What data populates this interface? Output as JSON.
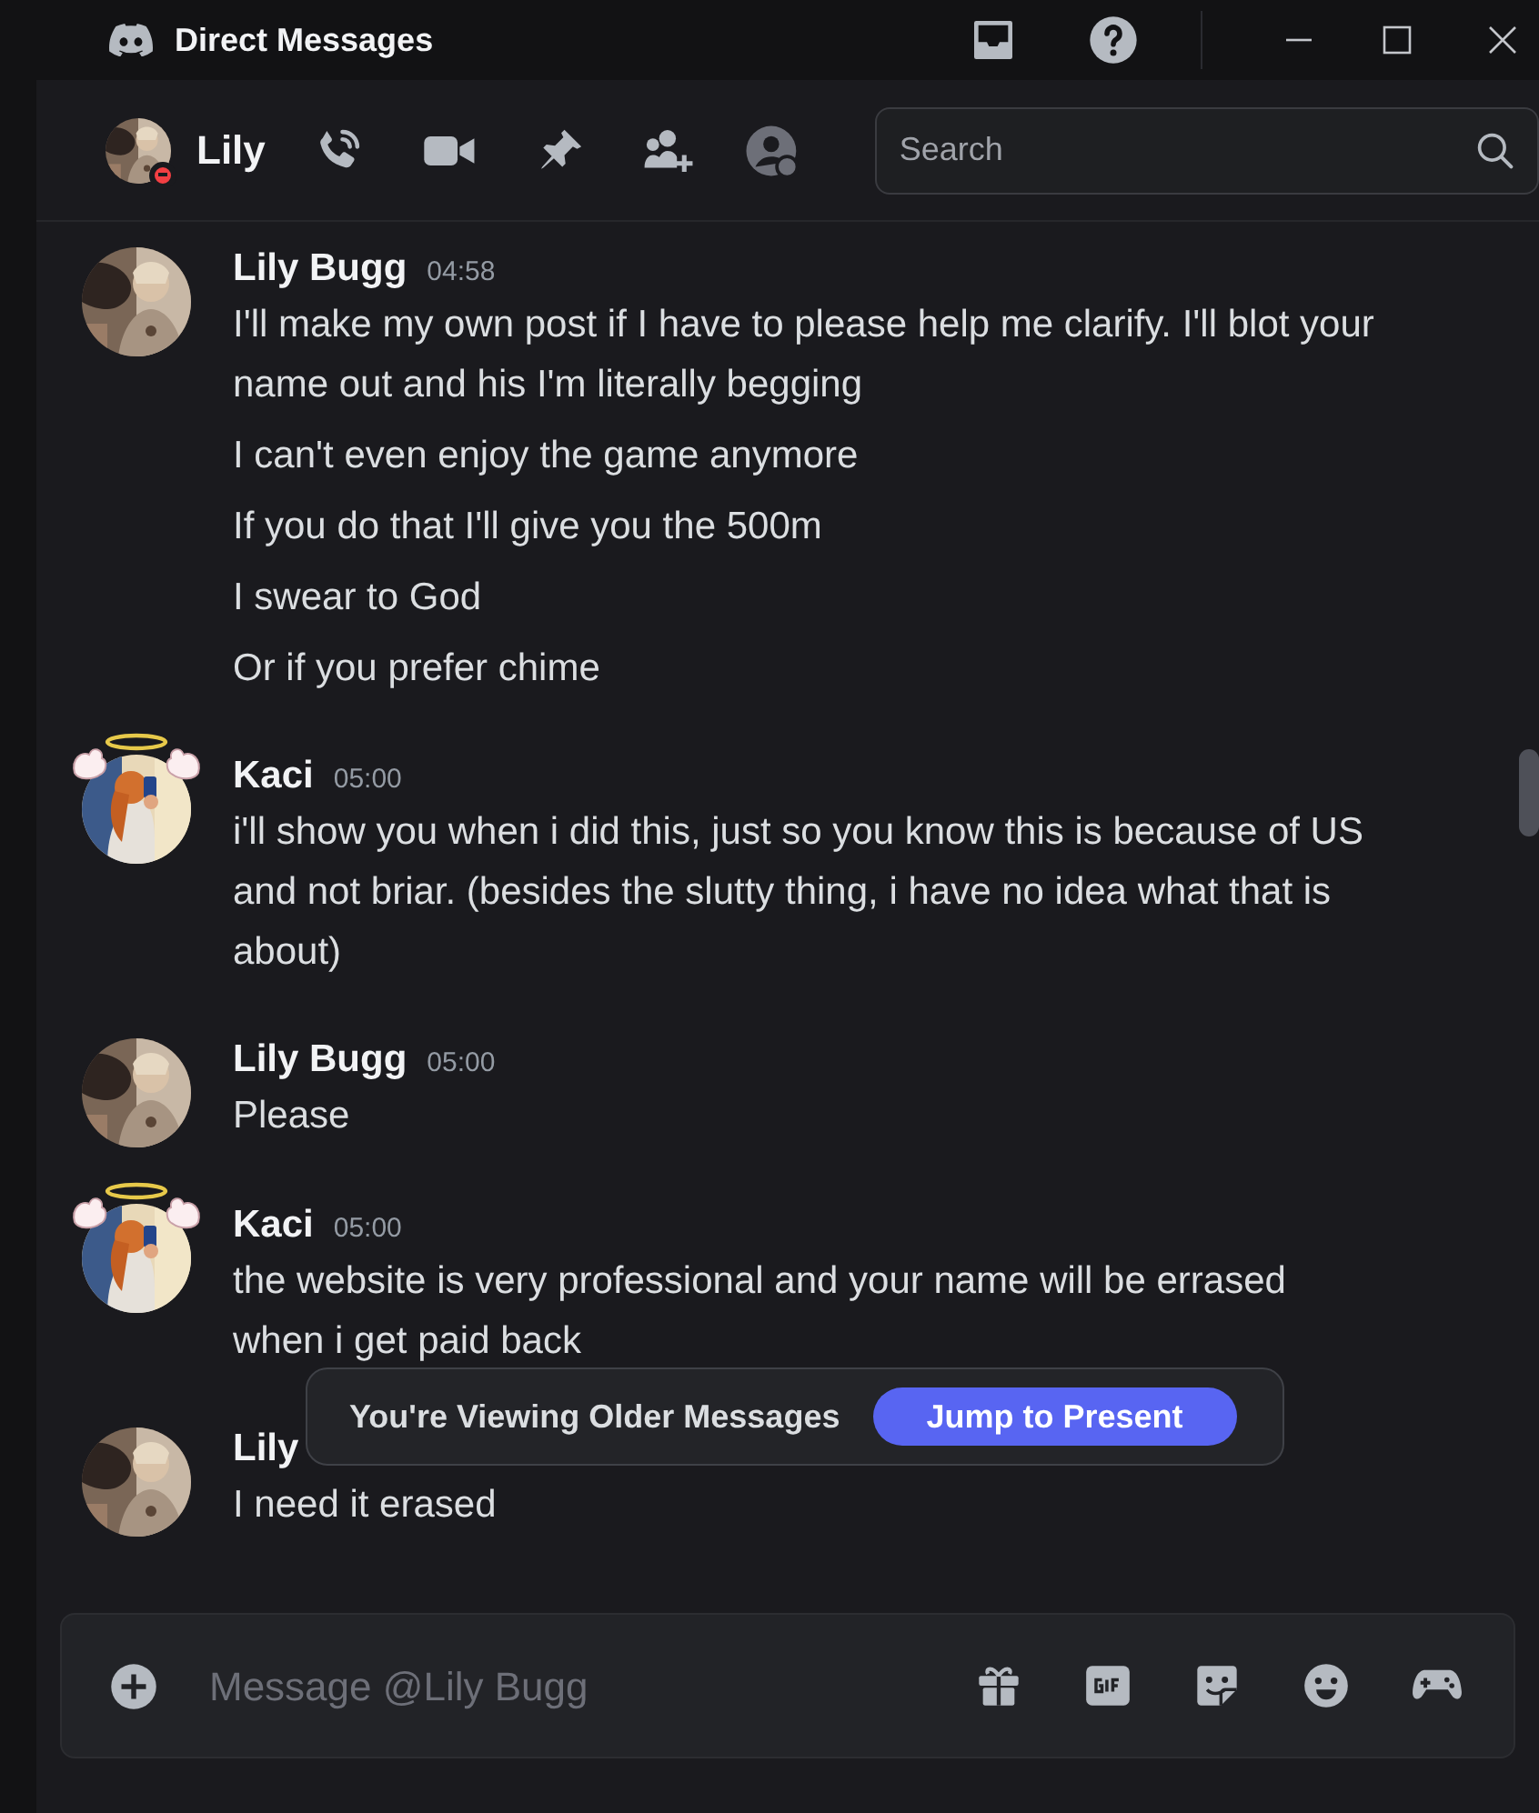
{
  "title_bar": {
    "title": "Direct Messages"
  },
  "header": {
    "name": "Lily",
    "do_not_disturb": true,
    "search": {
      "placeholder": "Search"
    }
  },
  "messages": [
    {
      "author": "Lily Bugg",
      "time": "04:58",
      "decorated": false,
      "lines": [
        "I'll make my own post if I have to please help me clarify. I'll blot your name out and his I'm literally begging",
        "I can't even enjoy the game anymore",
        "If you do that I'll give you the 500m",
        "I swear to God",
        "Or if you prefer chime"
      ]
    },
    {
      "author": "Kaci",
      "time": "05:00",
      "decorated": true,
      "lines": [
        "i'll show you when i did this, just so you know this is because of US and not briar. (besides the slutty thing, i have no idea what that is about)"
      ]
    },
    {
      "author": "Lily Bugg",
      "time": "05:00",
      "decorated": false,
      "lines": [
        "Please"
      ]
    },
    {
      "author": "Kaci",
      "time": "05:00",
      "decorated": true,
      "lines": [
        "the website is very professional and your name will be errased when i get paid back"
      ]
    },
    {
      "author": "Lily",
      "decorated": false,
      "lines": [
        "I need it erased"
      ]
    }
  ],
  "older_messages_bar": {
    "text": "You're Viewing Older Messages",
    "button": "Jump to Present"
  },
  "composer": {
    "placeholder": "Message @Lily Bugg"
  }
}
